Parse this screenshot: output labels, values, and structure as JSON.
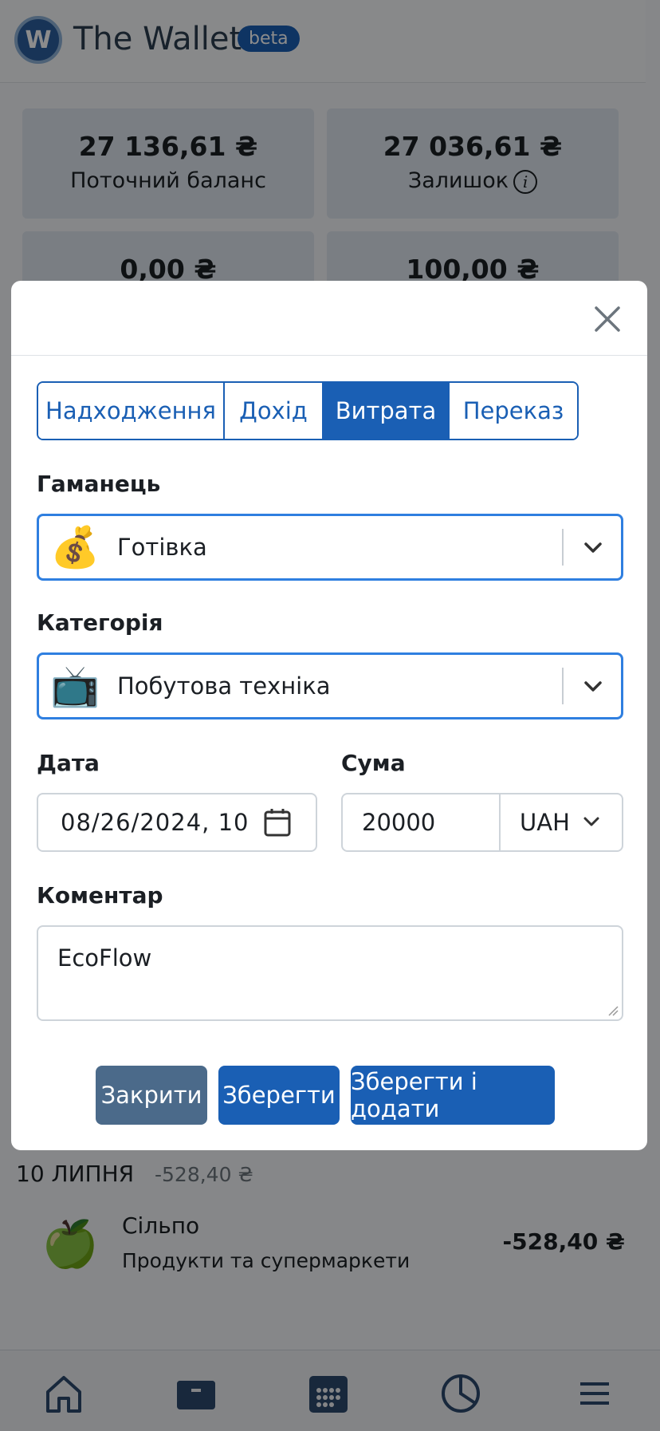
{
  "app": {
    "logo_letter": "W",
    "title": "The Wallet",
    "badge": "beta"
  },
  "cards": [
    {
      "amount": "27 136,61 ₴",
      "label": "Поточний баланс"
    },
    {
      "amount": "27 036,61 ₴",
      "label": "Залишок"
    },
    {
      "amount": "0,00 ₴"
    },
    {
      "amount": "100,00 ₴"
    }
  ],
  "info_icon_glyph": "i",
  "transactions": {
    "day_label": "10 ЛИПНЯ",
    "day_total": "-528,40 ₴",
    "items": [
      {
        "icon": "green-apple-icon",
        "emoji": "🍏",
        "title": "Сільпо",
        "category": "Продукти та супермаркети",
        "amount": "-528,40 ₴"
      }
    ]
  },
  "bottom_nav": [
    "home-icon",
    "wallet-icon",
    "calendar-icon",
    "pie-chart-icon",
    "menu-icon"
  ],
  "modal": {
    "tabs": [
      {
        "label": "Надходження",
        "active": false
      },
      {
        "label": "Дохід",
        "active": false
      },
      {
        "label": "Витрата",
        "active": true
      },
      {
        "label": "Переказ",
        "active": false
      }
    ],
    "wallet": {
      "label": "Гаманець",
      "emoji": "💰",
      "value": "Готівка"
    },
    "category": {
      "label": "Категорія",
      "emoji": "📺",
      "value": "Побутова техніка"
    },
    "date": {
      "label": "Дата",
      "value": "08/26/2024, 10"
    },
    "sum": {
      "label": "Сума",
      "value": "20000",
      "currency": "UAH"
    },
    "comment": {
      "label": "Коментар",
      "value": "EcoFlow"
    },
    "buttons": {
      "close": "Закрити",
      "save": "Зберегти",
      "save_add": "Зберегти і додати"
    }
  },
  "colors": {
    "primary": "#1a5fb4",
    "focus_border": "#2f7fe0",
    "close_button": "#4b6a8a",
    "card_bg": "#dfe6ee"
  }
}
